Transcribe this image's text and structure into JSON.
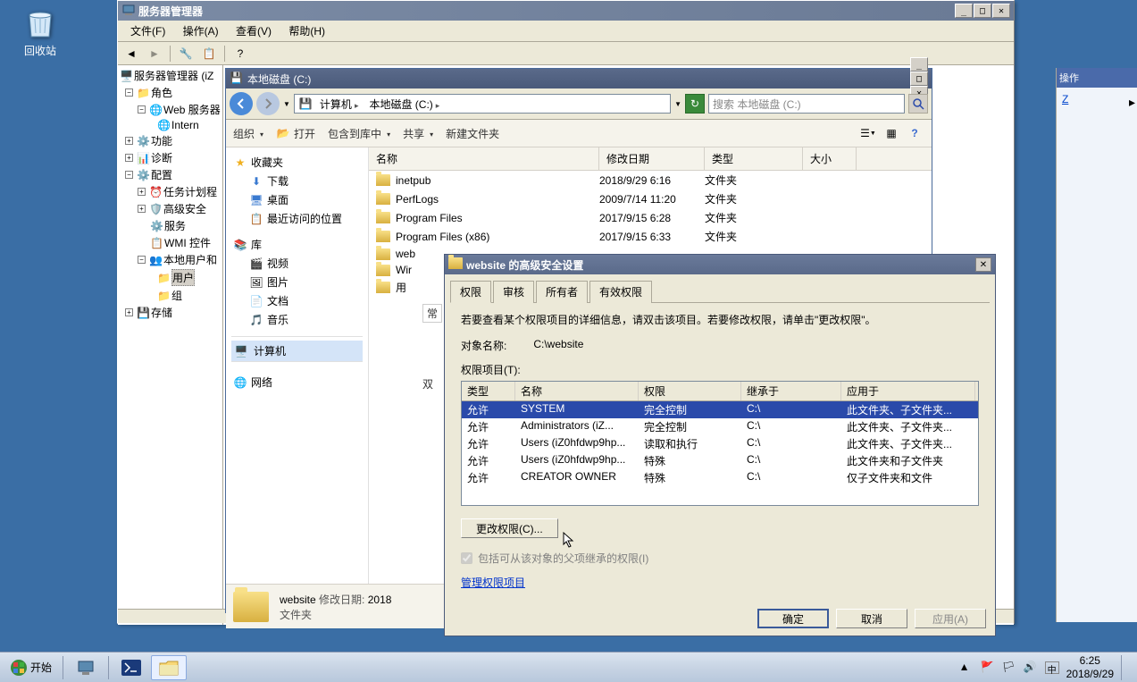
{
  "desktop": {
    "recycle_bin": "回收站"
  },
  "server_manager": {
    "title": "服务器管理器",
    "menu": {
      "file": "文件(F)",
      "action": "操作(A)",
      "view": "查看(V)",
      "help": "帮助(H)"
    },
    "tree": {
      "root": "服务器管理器 (iZ",
      "roles": "角色",
      "web_service": "Web 服务器",
      "internet": "Intern",
      "features": "功能",
      "diagnostics": "诊断",
      "config": "配置",
      "task_sched": "任务计划程",
      "adv_sec": "高级安全",
      "services": "服务",
      "wmi": "WMI 控件",
      "local_users": "本地用户和",
      "users": "用户",
      "groups": "组",
      "storage": "存储"
    }
  },
  "explorer": {
    "title": "本地磁盘 (C:)",
    "breadcrumb": {
      "computer": "计算机",
      "drive": "本地磁盘 (C:)"
    },
    "search_placeholder": "搜索 本地磁盘 (C:)",
    "toolbar": {
      "organize": "组织",
      "open": "打开",
      "include": "包含到库中",
      "share": "共享",
      "newfolder": "新建文件夹"
    },
    "sidebar": {
      "favorites": "收藏夹",
      "downloads": "下载",
      "desktop": "桌面",
      "recent": "最近访问的位置",
      "library": "库",
      "videos": "视频",
      "pictures": "图片",
      "documents": "文档",
      "music": "音乐",
      "computer": "计算机",
      "network": "网络"
    },
    "columns": {
      "name": "名称",
      "date": "修改日期",
      "type": "类型",
      "size": "大小"
    },
    "files": [
      {
        "name": "inetpub",
        "date": "2018/9/29 6:16",
        "type": "文件夹"
      },
      {
        "name": "PerfLogs",
        "date": "2009/7/14 11:20",
        "type": "文件夹"
      },
      {
        "name": "Program Files",
        "date": "2017/9/15 6:28",
        "type": "文件夹"
      },
      {
        "name": "Program Files (x86)",
        "date": "2017/9/15 6:33",
        "type": "文件夹"
      },
      {
        "name": "web",
        "date": "",
        "type": ""
      },
      {
        "name": "Wir",
        "date": "",
        "type": ""
      },
      {
        "name": "用",
        "date": "",
        "type": ""
      }
    ],
    "partial_cols": {
      "col_x": "双",
      "col_general": "常"
    },
    "details": {
      "name": "website",
      "date_label": "修改日期:",
      "date": "2018",
      "type": "文件夹"
    }
  },
  "security": {
    "title": "website 的高级安全设置",
    "tabs": {
      "perm": "权限",
      "audit": "审核",
      "owner": "所有者",
      "effective": "有效权限"
    },
    "hint": "若要查看某个权限项目的详细信息，请双击该项目。若要修改权限，请单击\"更改权限\"。",
    "obj_name_label": "对象名称:",
    "obj_name": "C:\\website",
    "perm_entries_label": "权限项目(T):",
    "cols": {
      "type": "类型",
      "name": "名称",
      "perm": "权限",
      "inherit": "继承于",
      "apply": "应用于"
    },
    "rows": [
      {
        "type": "允许",
        "name": "SYSTEM",
        "perm": "完全控制",
        "inherit": "C:\\",
        "apply": "此文件夹、子文件夹..."
      },
      {
        "type": "允许",
        "name": "Administrators (iZ...",
        "perm": "完全控制",
        "inherit": "C:\\",
        "apply": "此文件夹、子文件夹..."
      },
      {
        "type": "允许",
        "name": "Users (iZ0hfdwp9hp...",
        "perm": "读取和执行",
        "inherit": "C:\\",
        "apply": "此文件夹、子文件夹..."
      },
      {
        "type": "允许",
        "name": "Users (iZ0hfdwp9hp...",
        "perm": "特殊",
        "inherit": "C:\\",
        "apply": "此文件夹和子文件夹"
      },
      {
        "type": "允许",
        "name": "CREATOR OWNER",
        "perm": "特殊",
        "inherit": "C:\\",
        "apply": "仅子文件夹和文件"
      }
    ],
    "change_perm": "更改权限(C)...",
    "inherit_chk": "包括可从该对象的父项继承的权限(I)",
    "manage_link": "管理权限项目",
    "ok": "确定",
    "cancel": "取消",
    "apply_btn": "应用(A)"
  },
  "iis_actions": {
    "title": "操作",
    "link_z": "Z"
  },
  "taskbar": {
    "start": "开始",
    "clock": {
      "time": "6:25",
      "date": "2018/9/29"
    }
  }
}
